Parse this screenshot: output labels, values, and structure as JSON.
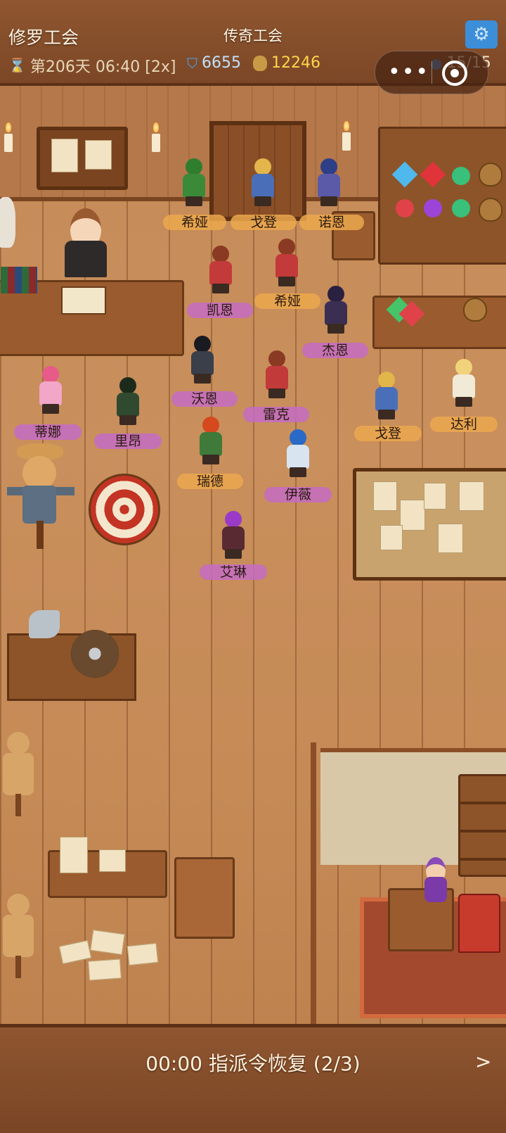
{
  "header": {
    "guild_name": "修罗工会",
    "guild_title": "传奇工会",
    "day_text": "第206天 06:40 [2x]",
    "defense": "6655",
    "gold": "12246",
    "population": "15/15",
    "icons": {
      "time": "hourglass-icon",
      "defense": "shield-icon",
      "gold": "money-bag-icon",
      "population": "person-icon",
      "settings": "gear-icon"
    }
  },
  "characters": [
    {
      "name": "希娅",
      "tag": "orange",
      "color": "#3a8a3a",
      "hair": "#2f7d2f"
    },
    {
      "name": "戈登",
      "tag": "orange",
      "color": "#4a6fb8",
      "hair": "#e2b64a"
    },
    {
      "name": "诺恩",
      "tag": "orange",
      "color": "#5a5aa8",
      "hair": "#2d3f86"
    },
    {
      "name": "凯恩",
      "tag": "purple",
      "color": "#c23a3a",
      "hair": "#8a3a22"
    },
    {
      "name": "希娅",
      "tag": "orange",
      "color": "#c23a3a",
      "hair": "#8a3a22"
    },
    {
      "name": "杰恩",
      "tag": "purple",
      "color": "#3a2f52",
      "hair": "#2a2040"
    },
    {
      "name": "沃恩",
      "tag": "purple",
      "color": "#3a3f4a",
      "hair": "#1a1a22"
    },
    {
      "name": "雷克",
      "tag": "purple",
      "color": "#c23a3a",
      "hair": "#8a3a22"
    },
    {
      "name": "蒂娜",
      "tag": "purple",
      "color": "#f2a6c8",
      "hair": "#e85a8a"
    },
    {
      "name": "里昂",
      "tag": "purple",
      "color": "#2f4a2f",
      "hair": "#1c2a1c"
    },
    {
      "name": "戈登",
      "tag": "orange",
      "color": "#4a6fb8",
      "hair": "#e2b64a"
    },
    {
      "name": "达利",
      "tag": "orange",
      "color": "#f1ead6",
      "hair": "#f0d37a"
    },
    {
      "name": "瑞德",
      "tag": "orange",
      "color": "#3f7a3a",
      "hair": "#d6481e"
    },
    {
      "name": "伊薇",
      "tag": "purple",
      "color": "#d8e4f0",
      "hair": "#2a6ac6"
    },
    {
      "name": "艾琳",
      "tag": "purple",
      "color": "#5a2a32",
      "hair": "#9a3ac6"
    }
  ],
  "footer": {
    "recover_text": "00:00 指派令恢复 (2/3)",
    "next_label": ">"
  }
}
